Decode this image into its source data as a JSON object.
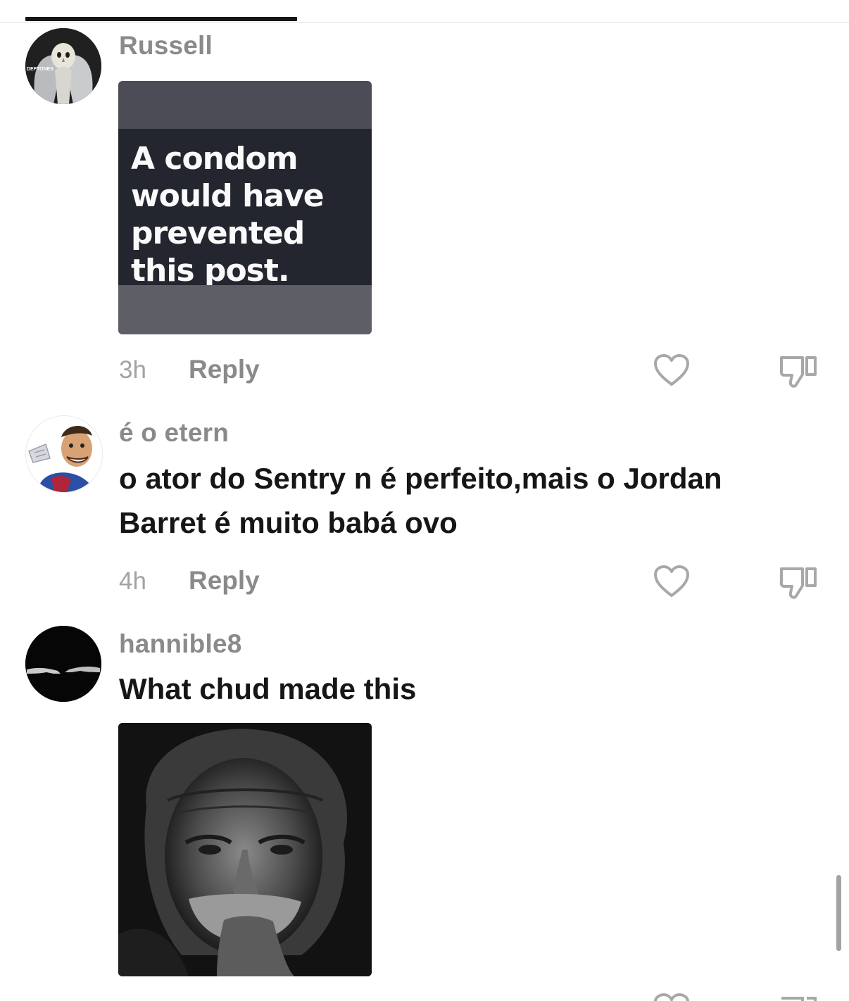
{
  "comments": [
    {
      "username": "Russell",
      "avatar_icon": "owl-avatar",
      "avatar_caption": "DEFTONES",
      "image_meme_text": "A condom would have prevented this post.",
      "time": "3h",
      "reply_label": "Reply"
    },
    {
      "username": "é o etern",
      "avatar_icon": "caricature-avatar",
      "text": "o ator do Sentry n é perfeito,mais o Jordan Barret é muito babá ovo",
      "time": "4h",
      "reply_label": "Reply"
    },
    {
      "username": "hannible8",
      "avatar_icon": "creation-hands-avatar",
      "text": "What chud made this",
      "image_icon": "old-man-portrait"
    }
  ],
  "icons": {
    "like": "heart-icon",
    "dislike": "thumbs-down-icon"
  },
  "colors": {
    "text": "#161616",
    "muted": "#8a8a8a",
    "meta": "#a3a3a3",
    "background": "#ffffff"
  }
}
